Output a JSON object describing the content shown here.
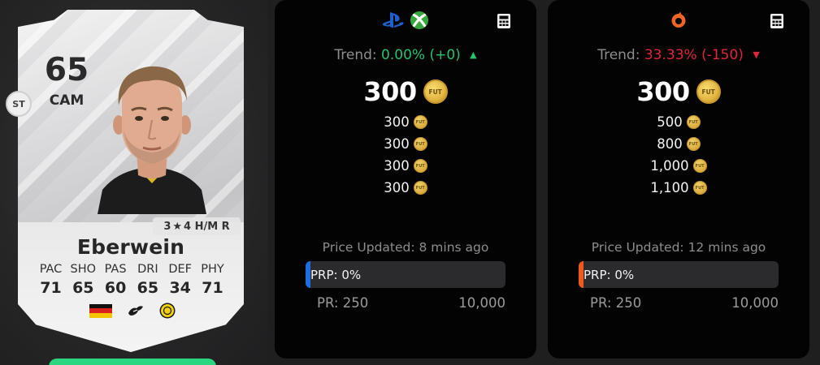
{
  "card": {
    "rating": "65",
    "position": "CAM",
    "alt_position": "ST",
    "skills_weakfoot": "3",
    "skills_rest": "4 H/M R",
    "name": "Eberwein",
    "stats": [
      {
        "label": "PAC",
        "value": "71"
      },
      {
        "label": "SHO",
        "value": "65"
      },
      {
        "label": "PAS",
        "value": "60"
      },
      {
        "label": "DRI",
        "value": "65"
      },
      {
        "label": "DEF",
        "value": "34"
      },
      {
        "label": "PHY",
        "value": "71"
      }
    ],
    "nation_icon": "germany-flag-icon",
    "league_icon": "bundesliga-eagle-icon",
    "club_icon": "dortmund-crest-icon"
  },
  "coin_text": "FUT",
  "panels": [
    {
      "id": "console",
      "platform_icons": [
        "playstation-icon",
        "xbox-icon"
      ],
      "accent": "#1b6fe0",
      "trend_label": "Trend:",
      "trend_value": "0.00% (+0)",
      "trend_direction": "up",
      "trend_color": "#25c36f",
      "main_price": "300",
      "prices": [
        "300",
        "300",
        "300",
        "300"
      ],
      "updated": "Price Updated: 8 mins ago",
      "prp_label": "PRP: 0%",
      "prp_value": 0,
      "range_min": "PR: 250",
      "range_max": "10,000"
    },
    {
      "id": "pc",
      "platform_icons": [
        "origin-icon"
      ],
      "accent": "#ee5a1c",
      "trend_label": "Trend:",
      "trend_value": "33.33% (-150)",
      "trend_direction": "down",
      "trend_color": "#e0263c",
      "main_price": "300",
      "prices": [
        "500",
        "800",
        "1,000",
        "1,100"
      ],
      "updated": "Price Updated: 12 mins ago",
      "prp_label": "PRP: 0%",
      "prp_value": 0,
      "range_min": "PR: 250",
      "range_max": "10,000"
    }
  ]
}
